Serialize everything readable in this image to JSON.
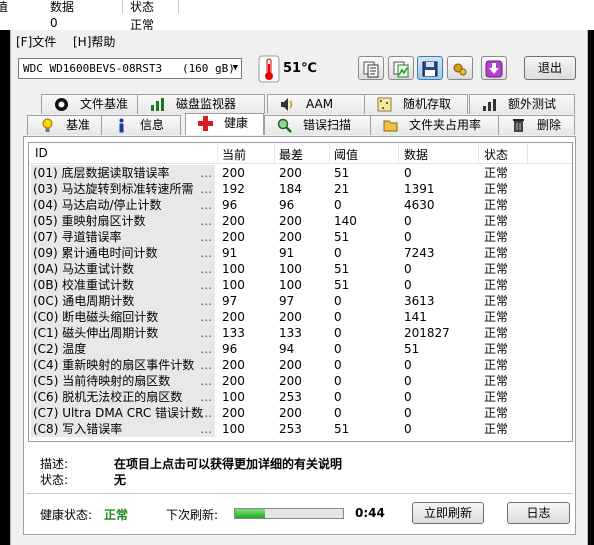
{
  "bg": {
    "col1": "值",
    "col2": "数据",
    "col3": "状态",
    "row_val1": "0",
    "row_val2": "正常"
  },
  "menu": {
    "file": "[F]文件",
    "help": "[H]帮助"
  },
  "toolbar": {
    "drive": "WDC WD1600BEVS-08RST3   (160 gB)",
    "temperature": "51℃",
    "exit_label": "退出",
    "icons": [
      "copy-text-icon",
      "copy-image-icon",
      "save-icon",
      "options-icon",
      "download-icon"
    ]
  },
  "tabs_row1": [
    {
      "label": "文件基准",
      "icon": "file-benchmark-icon"
    },
    {
      "label": "磁盘监视器",
      "icon": "disk-monitor-icon"
    },
    {
      "label": "AAM",
      "icon": "speaker-icon"
    },
    {
      "label": "随机存取",
      "icon": "random-access-icon"
    },
    {
      "label": "额外测试",
      "icon": "extra-tests-icon"
    }
  ],
  "tabs_row2": [
    {
      "label": "基准",
      "icon": "benchmark-icon"
    },
    {
      "label": "信息",
      "icon": "info-icon"
    },
    {
      "label": "健康",
      "icon": "health-cross-icon"
    },
    {
      "label": "错误扫描",
      "icon": "error-scan-icon"
    },
    {
      "label": "文件夹占用率",
      "icon": "folder-usage-icon"
    },
    {
      "label": "删除",
      "icon": "trash-icon"
    }
  ],
  "columns": [
    "ID",
    "当前",
    "最差",
    "阈值",
    "数据",
    "状态"
  ],
  "rows": [
    {
      "id": "(01) 底层数据读取错误率",
      "cur": "200",
      "worst": "200",
      "thr": "51",
      "data": "0",
      "status": "正常"
    },
    {
      "id": "(03) 马达旋转到标准转速所需",
      "cur": "192",
      "worst": "184",
      "thr": "21",
      "data": "1391",
      "status": "正常"
    },
    {
      "id": "(04) 马达启动/停止计数",
      "cur": "96",
      "worst": "96",
      "thr": "0",
      "data": "4630",
      "status": "正常"
    },
    {
      "id": "(05) 重映射扇区计数",
      "cur": "200",
      "worst": "200",
      "thr": "140",
      "data": "0",
      "status": "正常"
    },
    {
      "id": "(07) 寻道错误率",
      "cur": "200",
      "worst": "200",
      "thr": "51",
      "data": "0",
      "status": "正常"
    },
    {
      "id": "(09) 累计通电时间计数",
      "cur": "91",
      "worst": "91",
      "thr": "0",
      "data": "7243",
      "status": "正常"
    },
    {
      "id": "(0A) 马达重试计数",
      "cur": "100",
      "worst": "100",
      "thr": "51",
      "data": "0",
      "status": "正常"
    },
    {
      "id": "(0B) 校准重试计数",
      "cur": "100",
      "worst": "100",
      "thr": "51",
      "data": "0",
      "status": "正常"
    },
    {
      "id": "(0C) 通电周期计数",
      "cur": "97",
      "worst": "97",
      "thr": "0",
      "data": "3613",
      "status": "正常"
    },
    {
      "id": "(C0) 断电磁头缩回计数",
      "cur": "200",
      "worst": "200",
      "thr": "0",
      "data": "141",
      "status": "正常"
    },
    {
      "id": "(C1) 磁头伸出周期计数",
      "cur": "133",
      "worst": "133",
      "thr": "0",
      "data": "201827",
      "status": "正常"
    },
    {
      "id": "(C2) 温度",
      "cur": "96",
      "worst": "94",
      "thr": "0",
      "data": "51",
      "status": "正常"
    },
    {
      "id": "(C4) 重新映射的扇区事件计数",
      "cur": "200",
      "worst": "200",
      "thr": "0",
      "data": "0",
      "status": "正常"
    },
    {
      "id": "(C5) 当前待映射的扇区数",
      "cur": "200",
      "worst": "200",
      "thr": "0",
      "data": "0",
      "status": "正常"
    },
    {
      "id": "(C6) 脱机无法校正的扇区数",
      "cur": "100",
      "worst": "253",
      "thr": "0",
      "data": "0",
      "status": "正常"
    },
    {
      "id": "(C7) Ultra DMA CRC 错误计数",
      "cur": "200",
      "worst": "200",
      "thr": "0",
      "data": "0",
      "status": "正常"
    },
    {
      "id": "(C8) 写入错误率",
      "cur": "100",
      "worst": "253",
      "thr": "51",
      "data": "0",
      "status": "正常"
    }
  ],
  "details": {
    "desc_label": "描述:",
    "desc_value": "在项目上点击可以获得更加详细的有关说明",
    "status_label": "状态:",
    "status_value": "无"
  },
  "footer": {
    "health_label": "健康状态:",
    "health_value": "正常",
    "next_label": "下次刷新:",
    "progress_fraction": 0.28,
    "countdown": "0:44",
    "refresh_label": "立即刷新",
    "log_label": "日志"
  },
  "colors": {
    "ok_green": "#1a8a1a",
    "progress_green": "#1fae1f",
    "health_red": "#d42020"
  }
}
